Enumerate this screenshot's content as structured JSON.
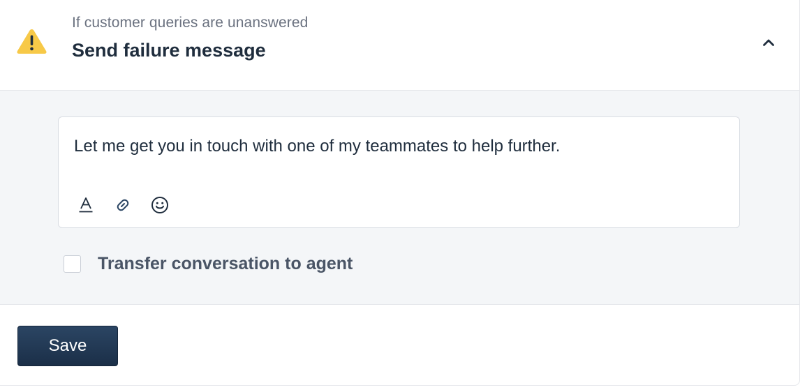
{
  "header": {
    "subtitle": "If customer queries are unanswered",
    "title": "Send failure message",
    "warning_icon": "warning-triangle-icon",
    "collapse_icon": "chevron-up-icon",
    "warning_color": "#f7c948"
  },
  "editor": {
    "text": "Let me get you in touch with one of my teammates to help further.",
    "toolbar": [
      {
        "name": "text-format-icon"
      },
      {
        "name": "link-icon"
      },
      {
        "name": "emoji-icon"
      }
    ]
  },
  "transfer": {
    "label": "Transfer conversation to agent",
    "checked": false
  },
  "footer": {
    "save_label": "Save",
    "save_color": "#1f3550"
  }
}
